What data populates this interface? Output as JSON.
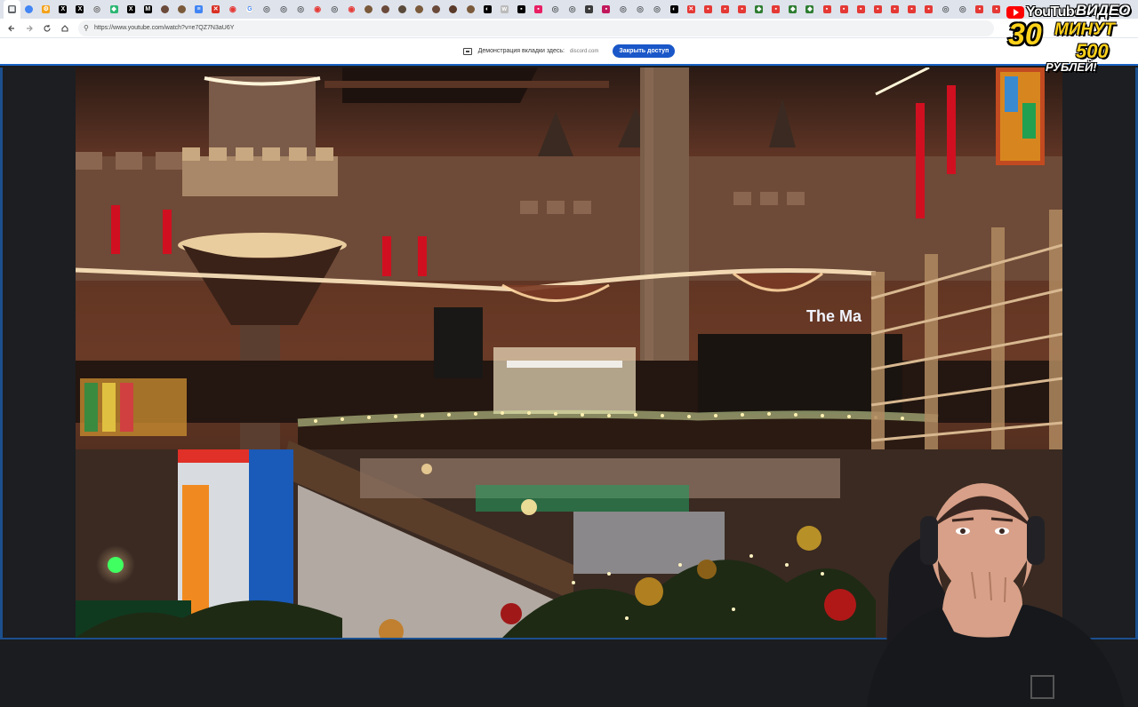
{
  "browser": {
    "tabs": [
      {
        "icon": "settings-icon",
        "color": "#5f6368",
        "glyph": "▦"
      },
      {
        "icon": "google-icon",
        "color": "#4285f4",
        "glyph": ""
      },
      {
        "icon": "generic-icon",
        "color": "#f4a21a",
        "glyph": "⚙"
      },
      {
        "icon": "x-icon",
        "color": "#000000",
        "glyph": "X"
      },
      {
        "icon": "x-icon",
        "color": "#000000",
        "glyph": "X"
      },
      {
        "icon": "generic-icon",
        "color": "#6b6b6b",
        "glyph": "◎"
      },
      {
        "icon": "generic-icon",
        "color": "#2bb673",
        "glyph": "◆"
      },
      {
        "icon": "x-icon",
        "color": "#000000",
        "glyph": "X"
      },
      {
        "icon": "medium-icon",
        "color": "#000000",
        "glyph": "M"
      },
      {
        "icon": "avatar-icon",
        "color": "#6a4a3a",
        "glyph": ""
      },
      {
        "icon": "avatar-icon",
        "color": "#7a5a3a",
        "glyph": ""
      },
      {
        "icon": "docs-icon",
        "color": "#4285f4",
        "glyph": "≡"
      },
      {
        "icon": "generic-icon",
        "color": "#d93025",
        "glyph": "✕"
      },
      {
        "icon": "generic-icon",
        "color": "#e53935",
        "glyph": "◉"
      },
      {
        "icon": "google-icon",
        "color": "#ffffff",
        "glyph": "G"
      },
      {
        "icon": "generic-icon",
        "color": "#5f6368",
        "glyph": "◎"
      },
      {
        "icon": "generic-icon",
        "color": "#5f6368",
        "glyph": "◎"
      },
      {
        "icon": "generic-icon",
        "color": "#5f6368",
        "glyph": "◎"
      },
      {
        "icon": "generic-icon",
        "color": "#e53935",
        "glyph": "◉"
      },
      {
        "icon": "generic-icon",
        "color": "#5f6368",
        "glyph": "◎"
      },
      {
        "icon": "generic-icon",
        "color": "#e53935",
        "glyph": "◉"
      },
      {
        "icon": "avatar-icon",
        "color": "#7a5a3a",
        "glyph": ""
      },
      {
        "icon": "avatar-icon",
        "color": "#6a4a3a",
        "glyph": ""
      },
      {
        "icon": "avatar-icon",
        "color": "#5a4a3a",
        "glyph": ""
      },
      {
        "icon": "avatar-icon",
        "color": "#7a5a3a",
        "glyph": ""
      },
      {
        "icon": "avatar-icon",
        "color": "#6a4a3a",
        "glyph": ""
      },
      {
        "icon": "avatar-icon",
        "color": "#5a3a2a",
        "glyph": ""
      },
      {
        "icon": "avatar-icon",
        "color": "#7a5a3a",
        "glyph": ""
      },
      {
        "icon": "github-icon",
        "color": "#000000",
        "glyph": "◐"
      },
      {
        "icon": "generic-icon",
        "color": "#bbbbbb",
        "glyph": "w"
      },
      {
        "icon": "generic-icon",
        "color": "#000000",
        "glyph": "▪"
      },
      {
        "icon": "generic-icon",
        "color": "#e91e63",
        "glyph": "▪"
      },
      {
        "icon": "generic-icon",
        "color": "#5f6368",
        "glyph": "◎"
      },
      {
        "icon": "generic-icon",
        "color": "#5f6368",
        "glyph": "◎"
      },
      {
        "icon": "generic-icon",
        "color": "#3b3b3b",
        "glyph": "▪"
      },
      {
        "icon": "generic-icon",
        "color": "#c2185b",
        "glyph": "▪"
      },
      {
        "icon": "generic-icon",
        "color": "#5f6368",
        "glyph": "◎"
      },
      {
        "icon": "generic-icon",
        "color": "#5f6368",
        "glyph": "◎"
      },
      {
        "icon": "generic-icon",
        "color": "#5f6368",
        "glyph": "◎"
      },
      {
        "icon": "generic-icon",
        "color": "#000000",
        "glyph": "◐"
      },
      {
        "icon": "generic-icon",
        "color": "#e53935",
        "glyph": "✕"
      },
      {
        "icon": "generic-icon",
        "color": "#e53935",
        "glyph": "▪"
      },
      {
        "icon": "generic-icon",
        "color": "#e53935",
        "glyph": "▪"
      },
      {
        "icon": "generic-icon",
        "color": "#e53935",
        "glyph": "▪"
      },
      {
        "icon": "generic-icon",
        "color": "#2e7d32",
        "glyph": "◆"
      },
      {
        "icon": "generic-icon",
        "color": "#e53935",
        "glyph": "▪"
      },
      {
        "icon": "generic-icon",
        "color": "#2e7d32",
        "glyph": "◆"
      },
      {
        "icon": "generic-icon",
        "color": "#2e7d32",
        "glyph": "◆"
      },
      {
        "icon": "generic-icon",
        "color": "#e53935",
        "glyph": "▪"
      },
      {
        "icon": "generic-icon",
        "color": "#e53935",
        "glyph": "▪"
      },
      {
        "icon": "generic-icon",
        "color": "#e53935",
        "glyph": "▪"
      },
      {
        "icon": "generic-icon",
        "color": "#e53935",
        "glyph": "▪"
      },
      {
        "icon": "generic-icon",
        "color": "#e53935",
        "glyph": "▪"
      },
      {
        "icon": "generic-icon",
        "color": "#e53935",
        "glyph": "▪"
      },
      {
        "icon": "generic-icon",
        "color": "#e53935",
        "glyph": "▪"
      },
      {
        "icon": "generic-icon",
        "color": "#5f6368",
        "glyph": "◎"
      },
      {
        "icon": "generic-icon",
        "color": "#5f6368",
        "glyph": "◎"
      },
      {
        "icon": "generic-icon",
        "color": "#e53935",
        "glyph": "▪"
      },
      {
        "icon": "generic-icon",
        "color": "#e53935",
        "glyph": "▪"
      },
      {
        "icon": "generic-icon",
        "color": "#5f6368",
        "glyph": "◎"
      }
    ],
    "url": "https://www.youtube.com/watch?v=e7QZ7N3aU6Y"
  },
  "share_bar": {
    "text": "Демонстрация вкладки здесь:",
    "domain": "discord.com",
    "close_button": "Закрыть доступ"
  },
  "promo": {
    "youtube": "YouTube",
    "video": "ВИДЕО",
    "thirty": "30",
    "minutes": "МИНУТ",
    "five_hundred": "500",
    "rubles": "РУБЛЕЙ!"
  },
  "video": {
    "sign_text": "The Ma"
  },
  "colors": {
    "accent": "#1a57c8",
    "share_border": "#1a63c4"
  }
}
